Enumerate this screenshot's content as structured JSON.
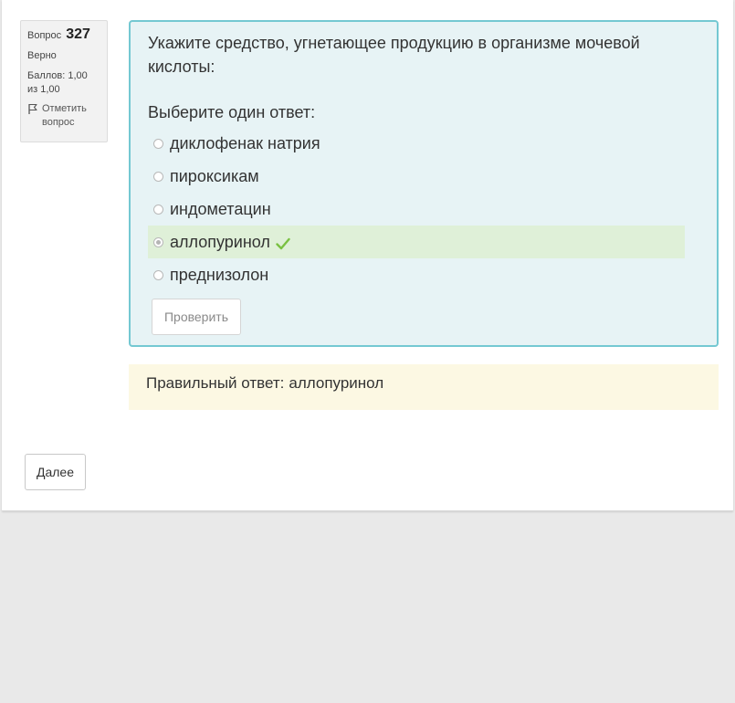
{
  "question_info": {
    "question_word": "Вопрос",
    "question_number": "327",
    "state": "Верно",
    "grade": "Баллов: 1,00 из 1,00",
    "flag_label": "Отметить вопрос"
  },
  "question": {
    "text": "Укажите средство, угнетающее продукцию в организме мочевой кислоты:",
    "prompt": "Выберите один ответ:",
    "answers": [
      {
        "label": "диклофенак натрия",
        "selected": false,
        "correct": false
      },
      {
        "label": "пироксикам",
        "selected": false,
        "correct": false
      },
      {
        "label": "индометацин",
        "selected": false,
        "correct": false
      },
      {
        "label": "аллопуринол",
        "selected": true,
        "correct": true
      },
      {
        "label": "преднизолон",
        "selected": false,
        "correct": false
      }
    ],
    "check_button": "Проверить"
  },
  "feedback": {
    "label": "Правильный ответ:",
    "answer": "аллопуринол"
  },
  "navigation": {
    "next_button": "Далее"
  },
  "colors": {
    "formulation_bg": "#e7f3f5",
    "formulation_border": "#74c8d2",
    "correct_bg": "#dff0d8",
    "feedback_bg": "#fcf8e3",
    "check_mark": "#7ac142"
  },
  "icons": {
    "flag": "flag-icon",
    "correct": "check-mark-icon"
  }
}
